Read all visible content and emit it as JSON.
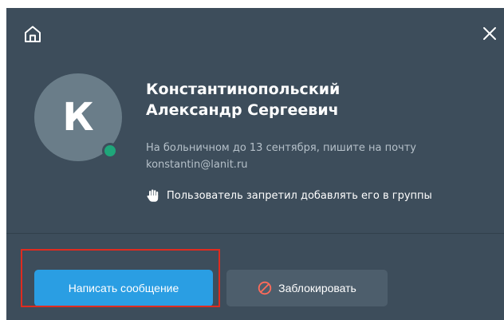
{
  "header": {
    "home_icon": "home-icon",
    "close_icon": "close-icon"
  },
  "profile": {
    "avatar_initial": "К",
    "online_status_color": "#1fa67a",
    "name_line1": "Константинопольский",
    "name_line2": "Александр Сергеевич",
    "status_line1": "На больничном до 13 сентября, пишите на почту",
    "status_line2": "konstantin@lanit.ru",
    "group_restriction": "Пользователь запретил добавлять его в группы"
  },
  "actions": {
    "message_label": "Написать сообщение",
    "block_label": "Заблокировать"
  },
  "colors": {
    "card_bg": "#3d4d5b",
    "primary": "#2a9ee3",
    "secondary": "#4d5e6c",
    "highlight": "#e02b1f",
    "block_icon": "#ff6b5a"
  }
}
